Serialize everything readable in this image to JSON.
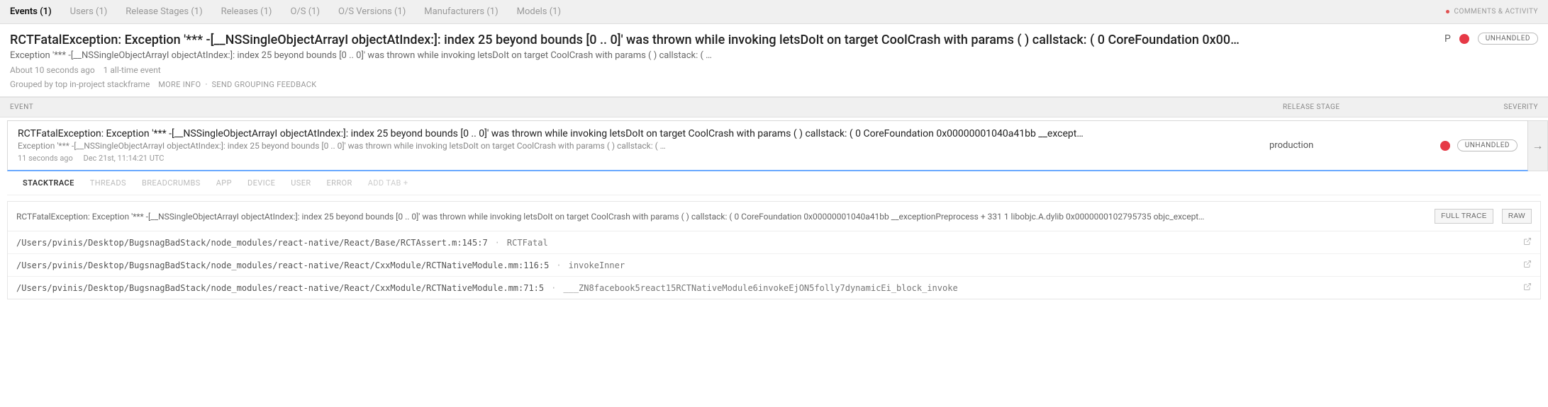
{
  "topTabs": [
    {
      "label": "Events (1)",
      "active": true
    },
    {
      "label": "Users (1)"
    },
    {
      "label": "Release Stages (1)"
    },
    {
      "label": "Releases (1)"
    },
    {
      "label": "O/S (1)"
    },
    {
      "label": "O/S Versions (1)"
    },
    {
      "label": "Manufacturers (1)"
    },
    {
      "label": "Models (1)"
    }
  ],
  "commentsLabel": "COMMENTS & ACTIVITY",
  "error": {
    "title": "RCTFatalException: Exception '*** -[__NSSingleObjectArrayI objectAtIndex:]: index 25 beyond bounds [0 .. 0]' was thrown while invoking letsDoIt on target CoolCrash with params ( ) callstack: ( 0 CoreFoundation 0x00…",
    "subtitle": "Exception '*** -[__NSSingleObjectArrayI objectAtIndex:]: index 25 beyond bounds [0 .. 0]' was thrown while invoking letsDoIt on target CoolCrash with params ( ) callstack: ( …",
    "age": "About 10 seconds ago",
    "count": "1 all-time event",
    "grouped": "Grouped by top in-project stackframe",
    "moreInfo": "MORE INFO",
    "sendFeedback": "SEND GROUPING FEEDBACK",
    "pLabel": "P",
    "pill": "UNHANDLED"
  },
  "columns": {
    "event": "EVENT",
    "stage": "RELEASE STAGE",
    "severity": "SEVERITY"
  },
  "event": {
    "title": "RCTFatalException: Exception '*** -[__NSSingleObjectArrayI objectAtIndex:]: index 25 beyond bounds [0 .. 0]' was thrown while invoking letsDoIt on target CoolCrash with params ( ) callstack: ( 0 CoreFoundation 0x00000001040a41bb __except…",
    "subtitle": "Exception '*** -[__NSSingleObjectArrayI objectAtIndex:]: index 25 beyond bounds [0 .. 0]' was thrown while invoking letsDoIt on target CoolCrash with params ( ) callstack: ( …",
    "ago": "11 seconds ago",
    "time": "Dec 21st, 11:14:21 UTC",
    "stage": "production",
    "pill": "UNHANDLED"
  },
  "detailTabs": [
    {
      "label": "STACKTRACE",
      "active": true
    },
    {
      "label": "THREADS"
    },
    {
      "label": "BREADCRUMBS"
    },
    {
      "label": "APP"
    },
    {
      "label": "DEVICE"
    },
    {
      "label": "USER"
    },
    {
      "label": "ERROR"
    },
    {
      "label": "ADD TAB +",
      "add": true
    }
  ],
  "trace": {
    "message": "RCTFatalException: Exception '*** -[__NSSingleObjectArrayI objectAtIndex:]: index 25 beyond bounds [0 .. 0]' was thrown while invoking letsDoIt on target CoolCrash with params ( ) callstack: ( 0 CoreFoundation 0x00000001040a41bb __exceptionPreprocess + 331 1 libobjc.A.dylib 0x0000000102795735 objc_except…",
    "fullTrace": "FULL TRACE",
    "raw": "RAW",
    "frames": [
      {
        "path": "/Users/pvinis/Desktop/BugsnagBadStack/node_modules/react-native/React/Base/RCTAssert.m:145:7",
        "fn": "RCTFatal"
      },
      {
        "path": "/Users/pvinis/Desktop/BugsnagBadStack/node_modules/react-native/React/CxxModule/RCTNativeModule.mm:116:5",
        "fn": "invokeInner"
      },
      {
        "path": "/Users/pvinis/Desktop/BugsnagBadStack/node_modules/react-native/React/CxxModule/RCTNativeModule.mm:71:5",
        "fn": "___ZN8facebook5react15RCTNativeModule6invokeEjON5folly7dynamicEi_block_invoke"
      }
    ]
  }
}
